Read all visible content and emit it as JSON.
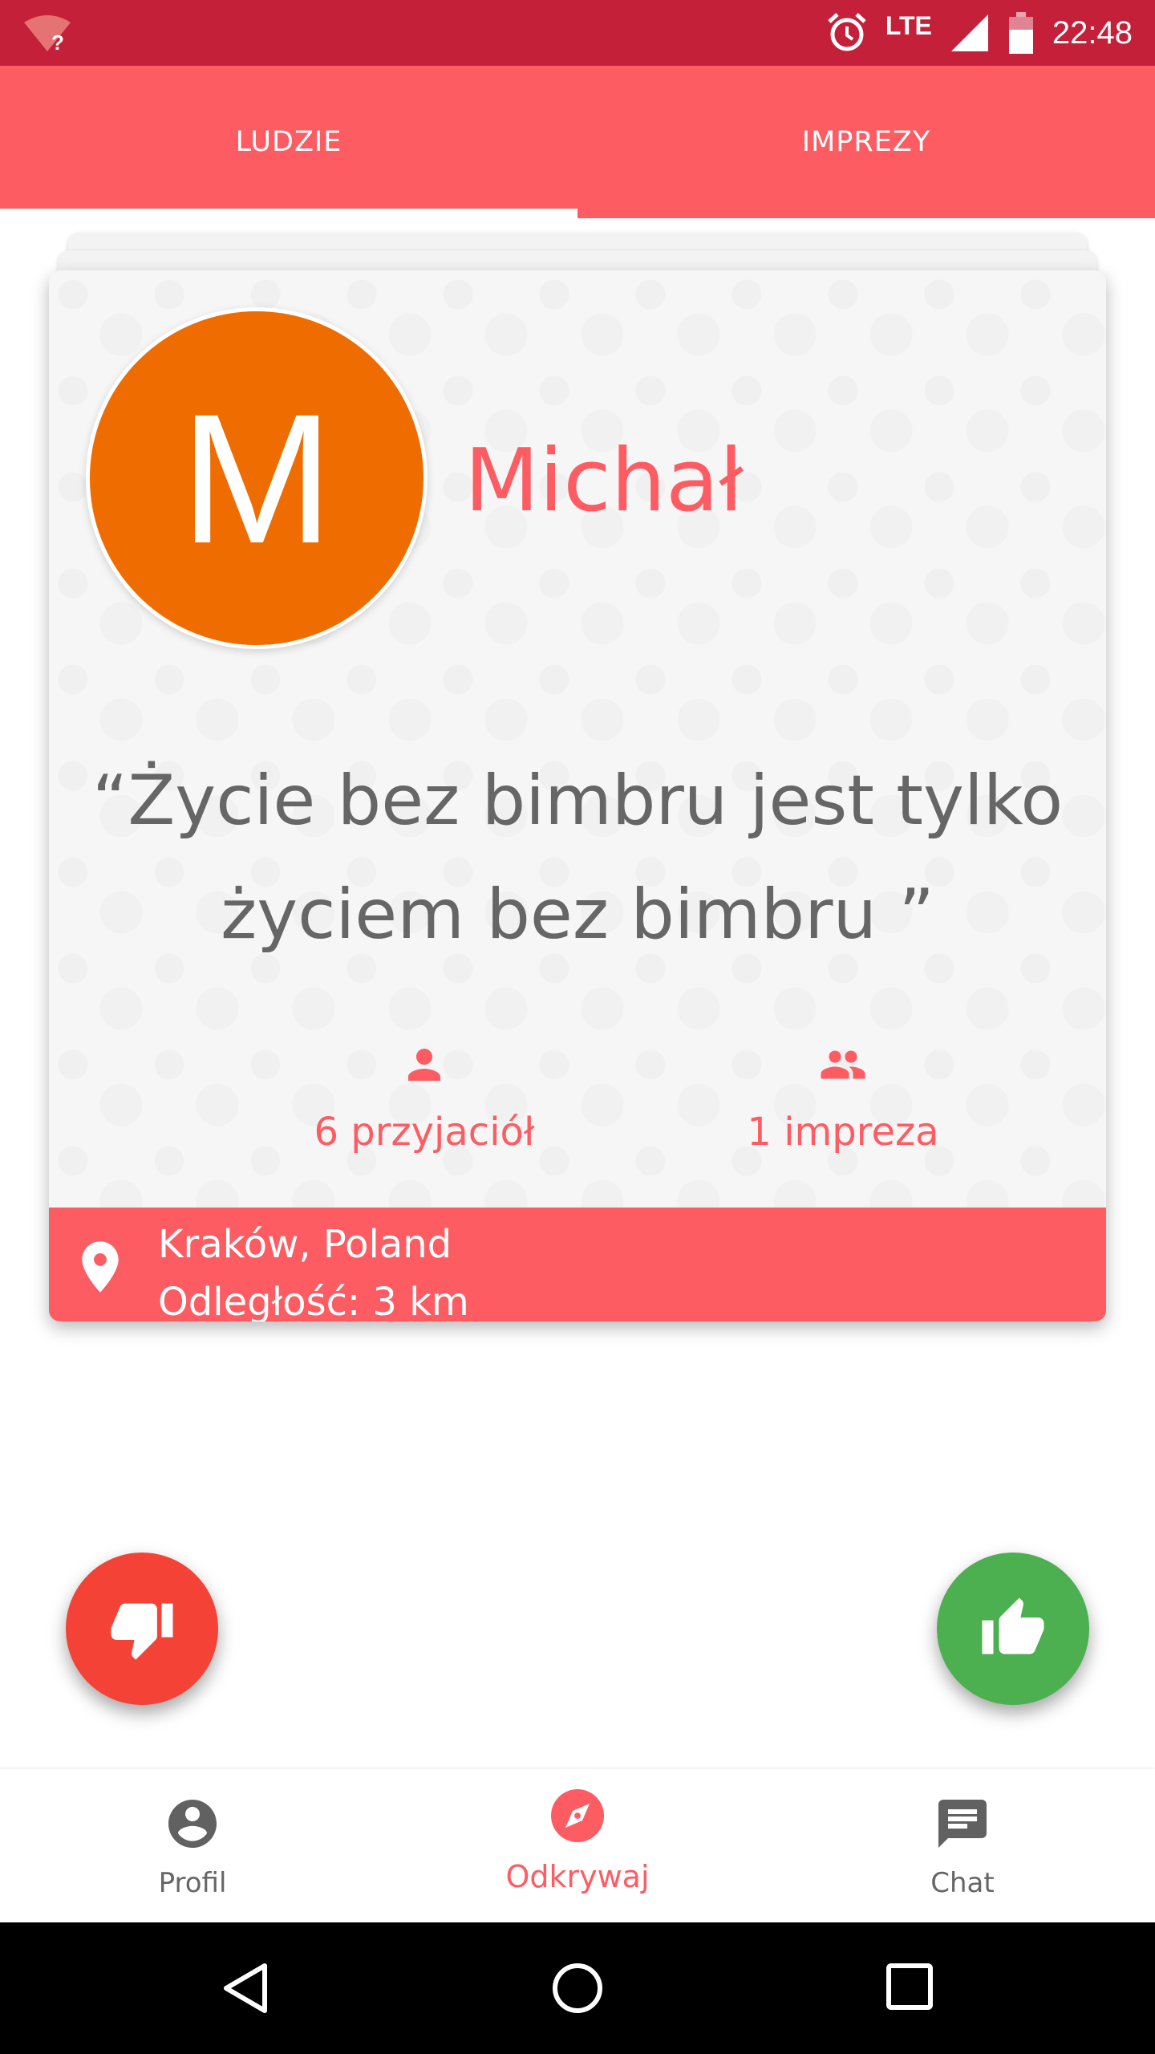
{
  "status_bar": {
    "time": "22:48",
    "network": "LTE",
    "icons": [
      "wifi-question-icon",
      "alarm-icon",
      "signal-icon",
      "battery-icon"
    ]
  },
  "tabs": [
    {
      "label": "LUDZIE",
      "active": true
    },
    {
      "label": "IMPREZY",
      "active": false
    }
  ],
  "profile": {
    "initial": "M",
    "name": "Michał",
    "quote": "“Życie bez bimbru jest tylko życiem bez bimbru ”",
    "friends": "6 przyjaciół",
    "events": "1 impreza",
    "location": "Kraków, Poland",
    "distance": "Odległość: 3 km"
  },
  "actions": {
    "dislike_icon": "thumbs-down-icon",
    "like_icon": "thumbs-up-icon"
  },
  "bottom_nav": [
    {
      "label": "Profil",
      "icon": "account-circle-icon",
      "active": false
    },
    {
      "label": "Odkrywaj",
      "icon": "compass-icon",
      "active": true
    },
    {
      "label": "Chat",
      "icon": "chat-icon",
      "active": false
    }
  ],
  "colors": {
    "status_bar": "#c5203a",
    "accent": "#fd5c63",
    "avatar": "#ef6c00",
    "dislike": "#f44336",
    "like": "#4caf50"
  }
}
